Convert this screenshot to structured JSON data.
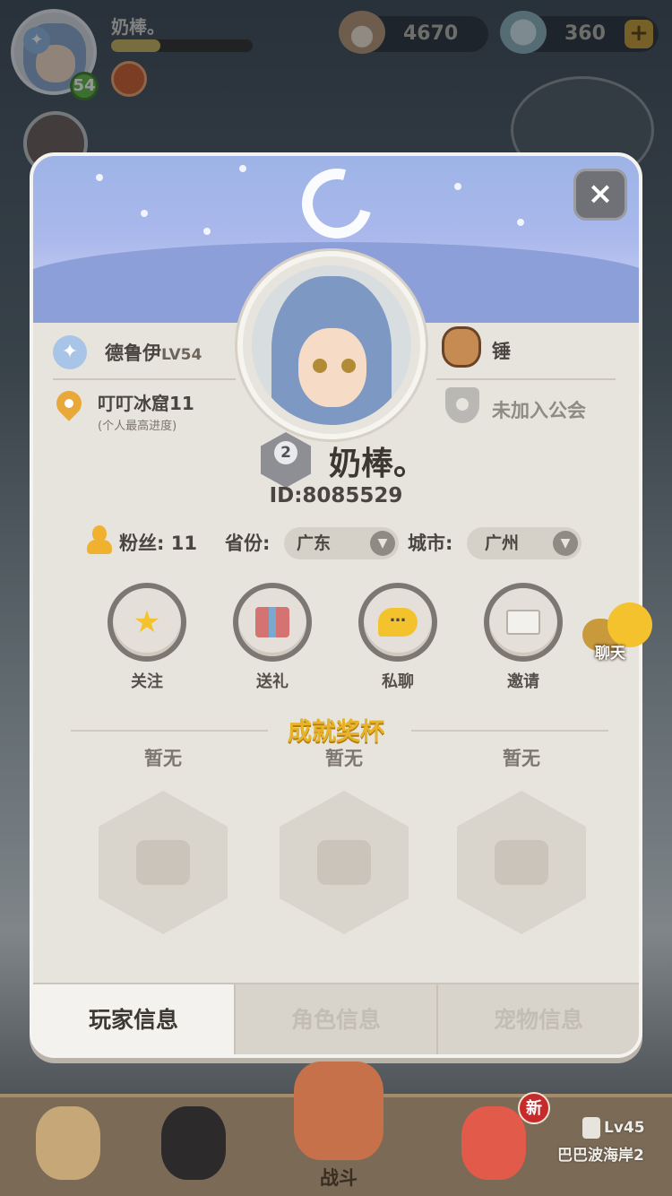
{
  "hud": {
    "player_name": "奶棒。",
    "level": "54",
    "exp_progress": 0.35,
    "shells": "4670",
    "pearls": "360",
    "plus": "+"
  },
  "profile": {
    "close": "×",
    "class_name": "德鲁伊",
    "class_level": "LV54",
    "location": "叮叮冰窟11",
    "location_note": "(个人最高进度)",
    "pet_name": "锤",
    "guild": "未加入公会",
    "rank": "2",
    "player_name": "奶棒。",
    "player_id": "ID:8085529",
    "fans": "粉丝: 11",
    "province_label": "省份:",
    "province_value": "广东",
    "city_label": "城市:",
    "city_value": "广州",
    "actions": [
      {
        "label": "关注",
        "icon": "star-icon"
      },
      {
        "label": "送礼",
        "icon": "gift-icon"
      },
      {
        "label": "私聊",
        "icon": "chat-bubble-icon"
      },
      {
        "label": "邀请",
        "icon": "envelope-icon"
      }
    ],
    "chat_float": "聊天",
    "trophy_title": "成就奖杯",
    "trophies": [
      "暂无",
      "暂无",
      "暂无"
    ],
    "tabs": [
      "玩家信息",
      "角色信息",
      "宠物信息"
    ]
  },
  "bottom_nav": {
    "battle_label": "战斗",
    "new_badge": "新",
    "locked_level": "Lv45",
    "locked_name": "巴巴波海岸2"
  },
  "colors": {
    "accent_gold": "#e7b427",
    "panel": "#e7e3dd",
    "level_green": "#5fb63e"
  }
}
